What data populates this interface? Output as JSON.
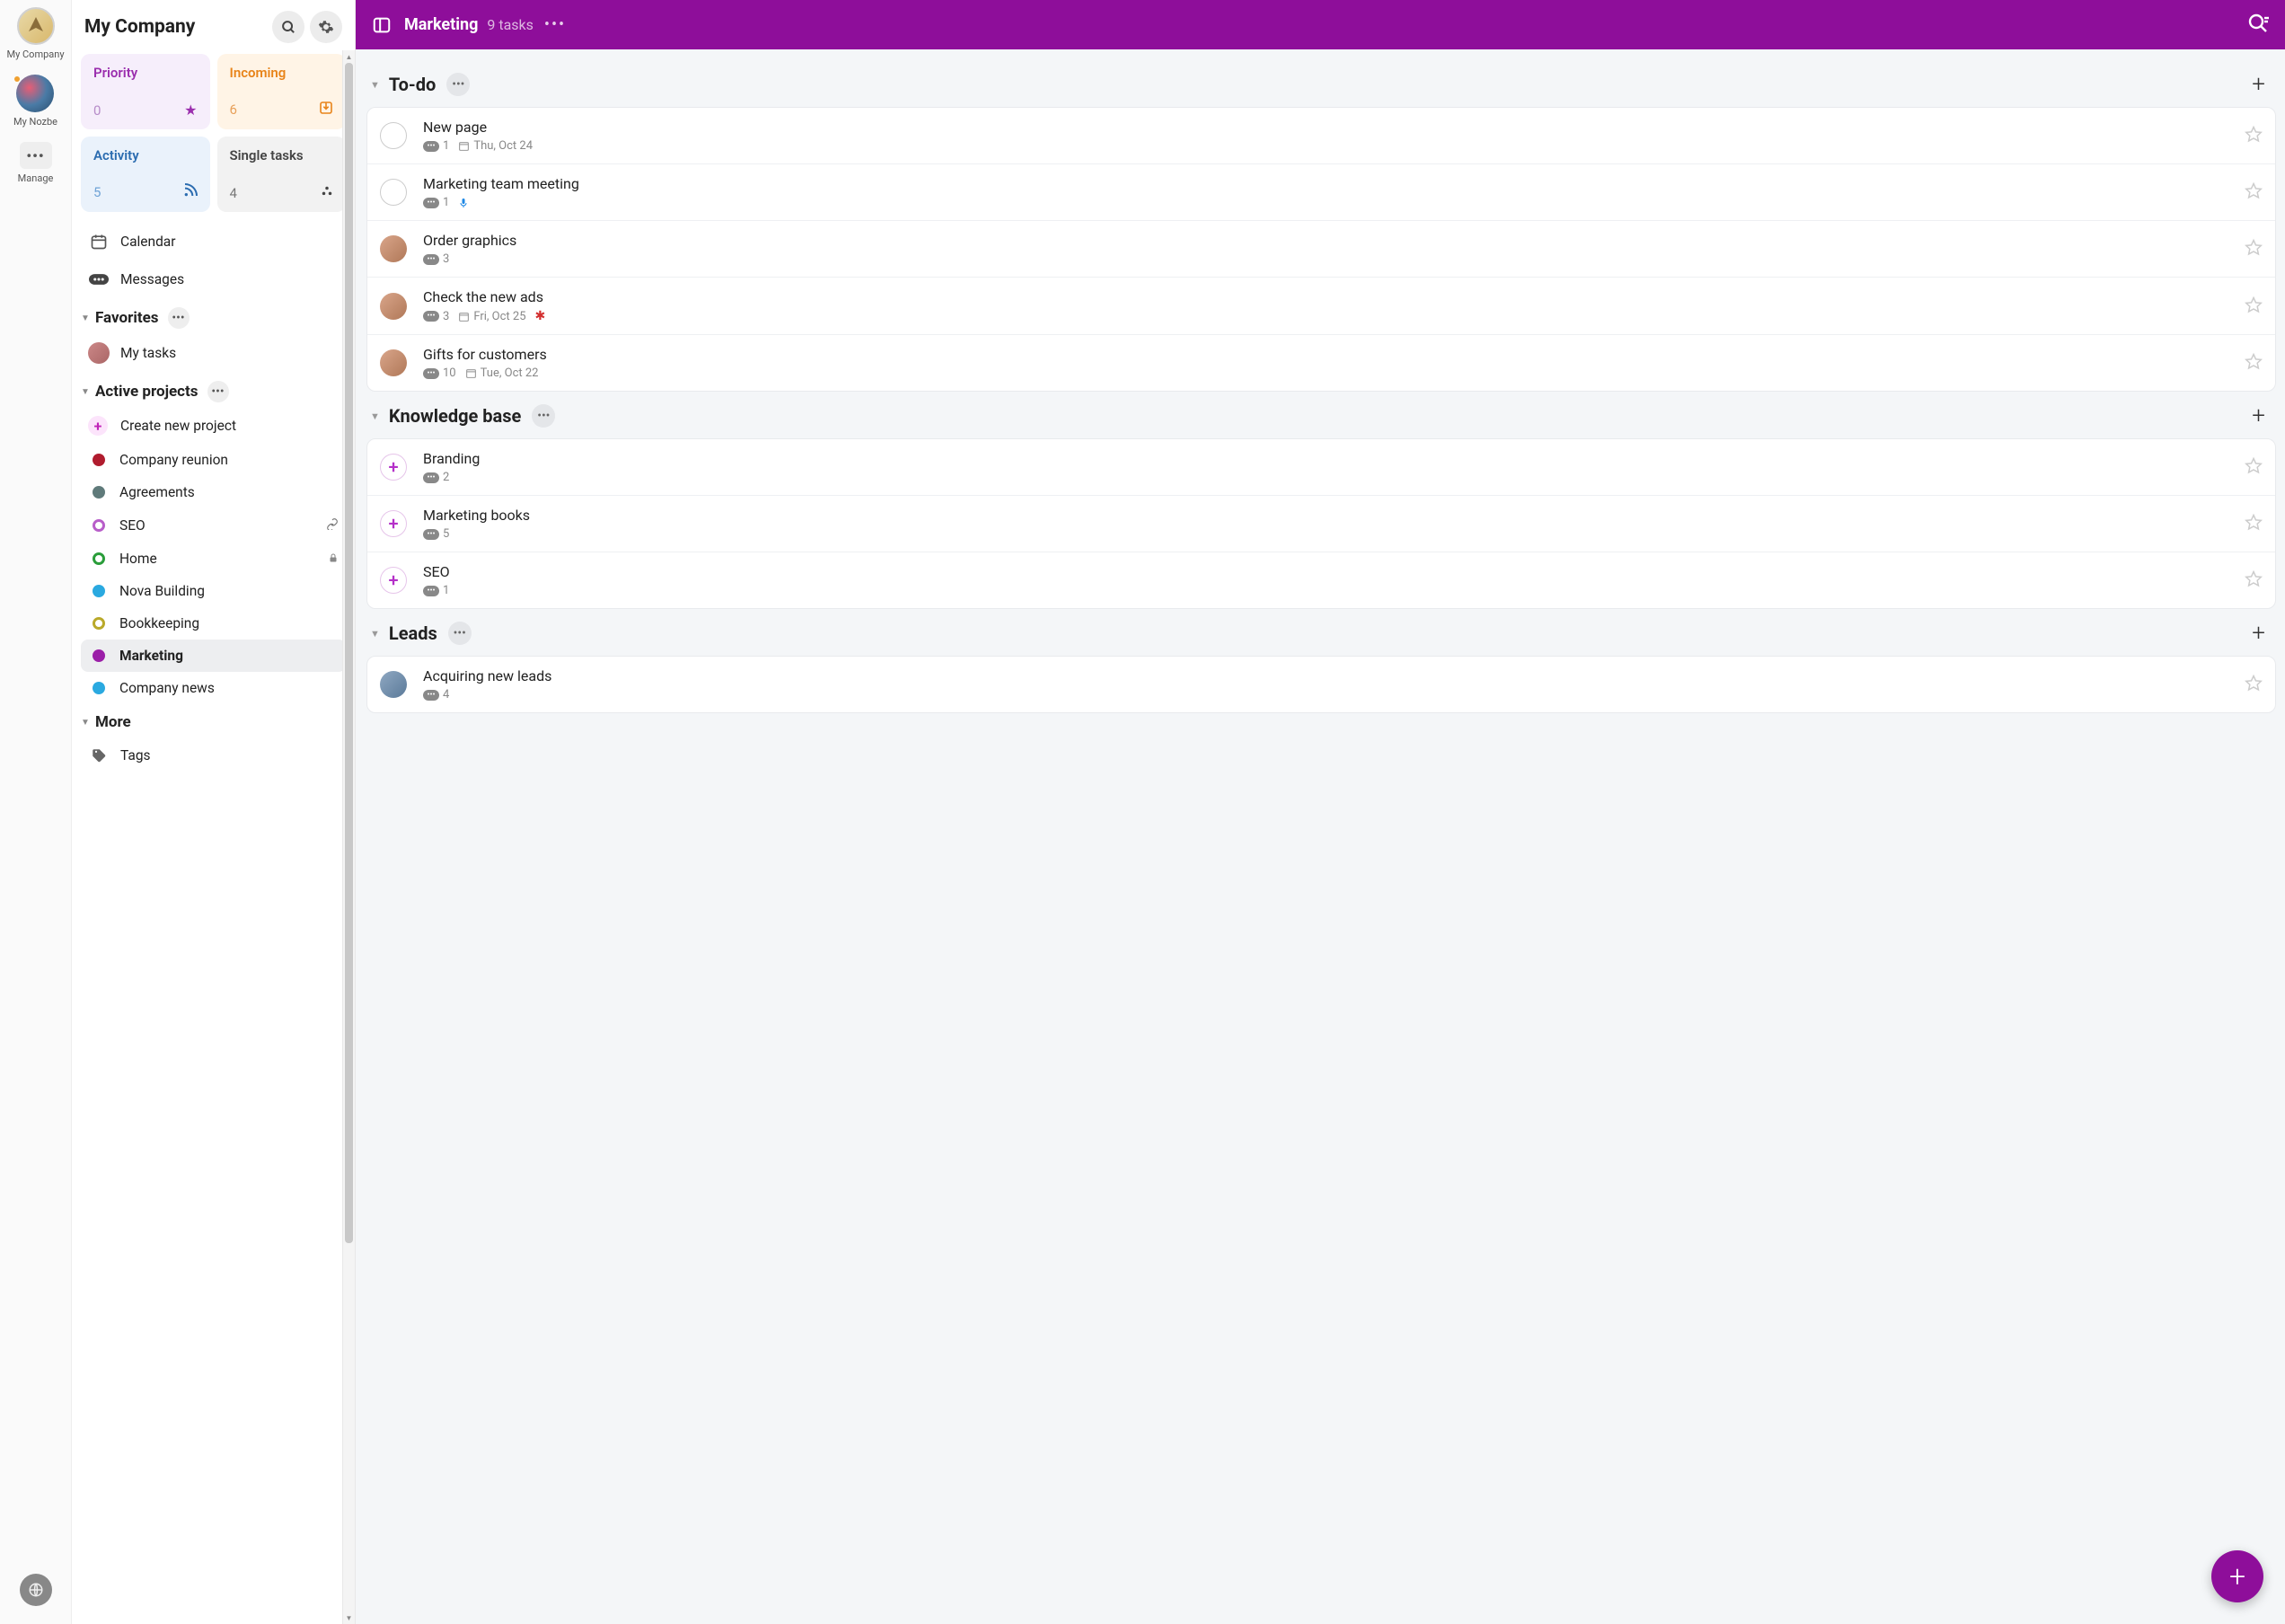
{
  "rail": {
    "company_label": "My Company",
    "nozbe_label": "My Nozbe",
    "manage_label": "Manage"
  },
  "sidebar": {
    "title": "My Company",
    "cards": {
      "priority": {
        "title": "Priority",
        "count": "0"
      },
      "incoming": {
        "title": "Incoming",
        "count": "6"
      },
      "activity": {
        "title": "Activity",
        "count": "5"
      },
      "single": {
        "title": "Single tasks",
        "count": "4"
      }
    },
    "calendar": "Calendar",
    "messages": "Messages",
    "favorites_title": "Favorites",
    "my_tasks": "My tasks",
    "active_title": "Active projects",
    "create_project": "Create new project",
    "projects": [
      {
        "label": "Company reunion",
        "color": "#b01c2e",
        "ring": false,
        "badge": ""
      },
      {
        "label": "Agreements",
        "color": "#5f7a7a",
        "ring": false,
        "badge": ""
      },
      {
        "label": "SEO",
        "color": "#b85ec9",
        "ring": true,
        "badge": "link"
      },
      {
        "label": "Home",
        "color": "#2a9d3a",
        "ring": true,
        "badge": "lock"
      },
      {
        "label": "Nova Building",
        "color": "#2aa9e0",
        "ring": false,
        "badge": ""
      },
      {
        "label": "Bookkeeping",
        "color": "#b9a92a",
        "ring": true,
        "badge": ""
      },
      {
        "label": "Marketing",
        "color": "#9b1fa8",
        "ring": false,
        "badge": "",
        "active": true
      },
      {
        "label": "Company news",
        "color": "#2aa9e0",
        "ring": false,
        "badge": ""
      }
    ],
    "more_title": "More",
    "tags": "Tags"
  },
  "header": {
    "title": "Marketing",
    "subtitle": "9 tasks"
  },
  "groups": [
    {
      "title": "To-do",
      "tasks": [
        {
          "title": "New page",
          "check": "empty",
          "comments": "1",
          "date": "Thu, Oct 24",
          "extra": ""
        },
        {
          "title": "Marketing team meeting",
          "check": "empty",
          "comments": "1",
          "date": "",
          "extra": "mic"
        },
        {
          "title": "Order graphics",
          "check": "avatar",
          "comments": "3",
          "date": "",
          "extra": ""
        },
        {
          "title": "Check the new ads",
          "check": "avatar",
          "comments": "3",
          "date": "Fri, Oct 25",
          "extra": "med"
        },
        {
          "title": "Gifts for customers",
          "check": "avatar",
          "comments": "10",
          "date": "Tue, Oct 22",
          "extra": ""
        }
      ]
    },
    {
      "title": "Knowledge base",
      "tasks": [
        {
          "title": "Branding",
          "check": "plus",
          "comments": "2",
          "date": "",
          "extra": ""
        },
        {
          "title": "Marketing books",
          "check": "plus",
          "comments": "5",
          "date": "",
          "extra": ""
        },
        {
          "title": "SEO",
          "check": "plus",
          "comments": "1",
          "date": "",
          "extra": ""
        }
      ]
    },
    {
      "title": "Leads",
      "tasks": [
        {
          "title": "Acquiring new leads",
          "check": "avatar2",
          "comments": "4",
          "date": "",
          "extra": ""
        }
      ]
    }
  ]
}
